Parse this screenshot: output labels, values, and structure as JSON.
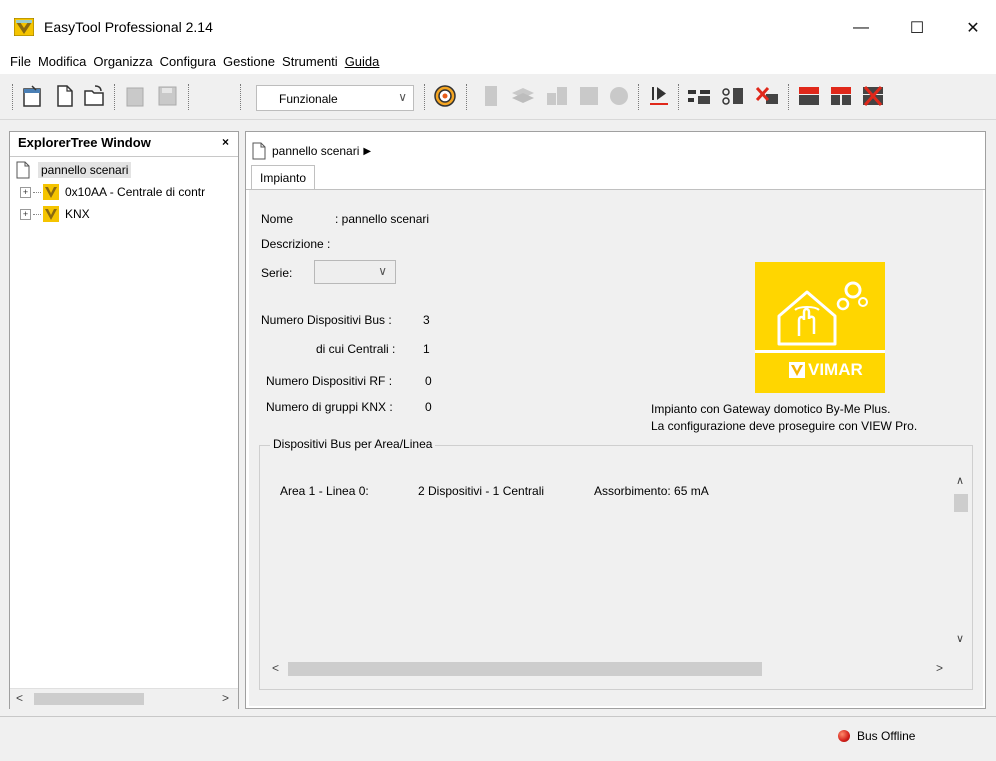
{
  "window": {
    "title": "EasyTool Professional 2.14",
    "minimize_glyph": "—",
    "maximize_glyph": "☐",
    "close_glyph": "✕"
  },
  "menu": [
    "File",
    "Modifica",
    "Organizza",
    "Configura",
    "Gestione",
    "Strumenti",
    "Guida"
  ],
  "toolbar": {
    "view_select_value": "Funzionale"
  },
  "explorer": {
    "title": "ExplorerTree Window",
    "close_glyph": "×",
    "items": [
      {
        "label": "pannello scenari"
      },
      {
        "label": "0x10AA - Centrale di contr"
      },
      {
        "label": "KNX"
      }
    ]
  },
  "main": {
    "breadcrumb": "pannello scenari",
    "tab": "Impianto",
    "nome_label": "Nome",
    "nome_value": ": pannello scenari",
    "descrizione_label": "Descrizione :",
    "serie_label": "Serie:",
    "bus_label": "Numero Dispositivi Bus :",
    "bus_value": "3",
    "centrali_label": "di cui Centrali :",
    "centrali_value": "1",
    "rf_label": "Numero Dispositivi RF :",
    "rf_value": "0",
    "knx_label": "Numero di gruppi KNX :",
    "knx_value": "0",
    "logo_text": "VIMAR",
    "info_line1": "Impianto con Gateway domotico By-Me Plus.",
    "info_line2": "La configurazione deve proseguire con VIEW Pro.",
    "group_title": "Dispositivi Bus per Area/Linea",
    "area_row": {
      "area": "Area 1 - Linea 0:",
      "devices": "2 Dispositivi - 1 Centrali",
      "absorption": "Assorbimento:  65 mA"
    }
  },
  "status": {
    "bus": "Bus Offline"
  },
  "colors": {
    "vimar_yellow": "#ffd600",
    "status_red": "#d2201a"
  }
}
